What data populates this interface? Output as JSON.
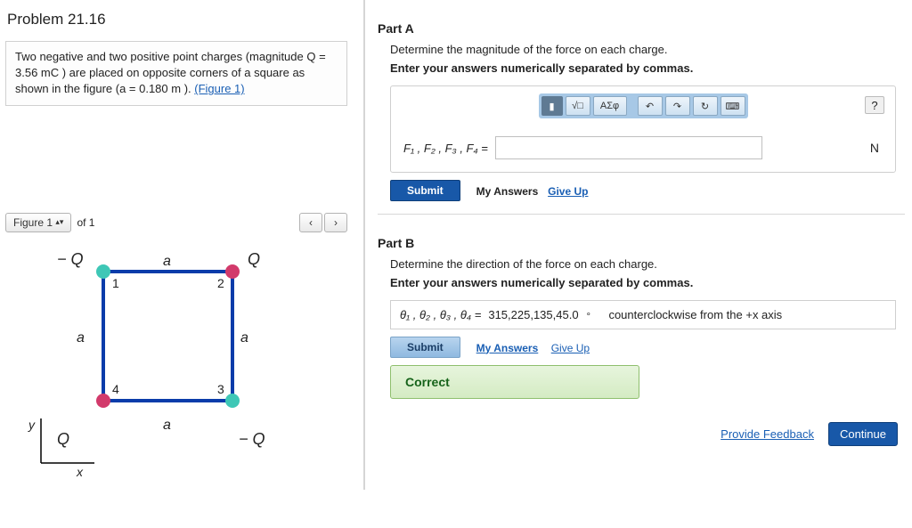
{
  "problem": {
    "title": "Problem 21.16",
    "description_pre": "Two negative and two positive point charges (magnitude Q = 3.56 mC ) are placed on opposite corners of a square as shown in the figure (a = 0.180 m ).",
    "figure_link": "(Figure 1)"
  },
  "figure_nav": {
    "label": "Figure",
    "index": "1",
    "of_label": "of 1",
    "prev": "‹",
    "next": "›"
  },
  "figure": {
    "minusQ": "− Q",
    "plusQ": "Q",
    "a": "a",
    "x": "x",
    "y": "y",
    "n1": "1",
    "n2": "2",
    "n3": "3",
    "n4": "4"
  },
  "partA": {
    "heading": "Part A",
    "instruction": "Determine the magnitude of the force on each charge.",
    "instruction_bold": "Enter your answers numerically separated by commas.",
    "var_label": "F₁ , F₂ , F₃ , F₄ =",
    "unit": "N",
    "toolbar": {
      "t1": "▮",
      "t2": "√□",
      "t3": "ΑΣφ",
      "undo": "↶",
      "redo": "↷",
      "reset": "↻",
      "kbd": "⌨",
      "help": "?"
    },
    "submit": "Submit",
    "my_answers": "My Answers",
    "give_up": "Give Up"
  },
  "partB": {
    "heading": "Part B",
    "instruction": "Determine the direction of the force on each charge.",
    "instruction_bold": "Enter your answers numerically separated by commas.",
    "var_label": "θ₁ , θ₂ , θ₃ , θ₄  =",
    "value": "315,225,135,45.0",
    "deg": "∘",
    "trail": "counterclockwise from the +x axis",
    "submit": "Submit",
    "my_answers": "My Answers",
    "give_up": "Give Up",
    "correct": "Correct"
  },
  "footer": {
    "provide_feedback": "Provide Feedback",
    "continue": "Continue"
  }
}
